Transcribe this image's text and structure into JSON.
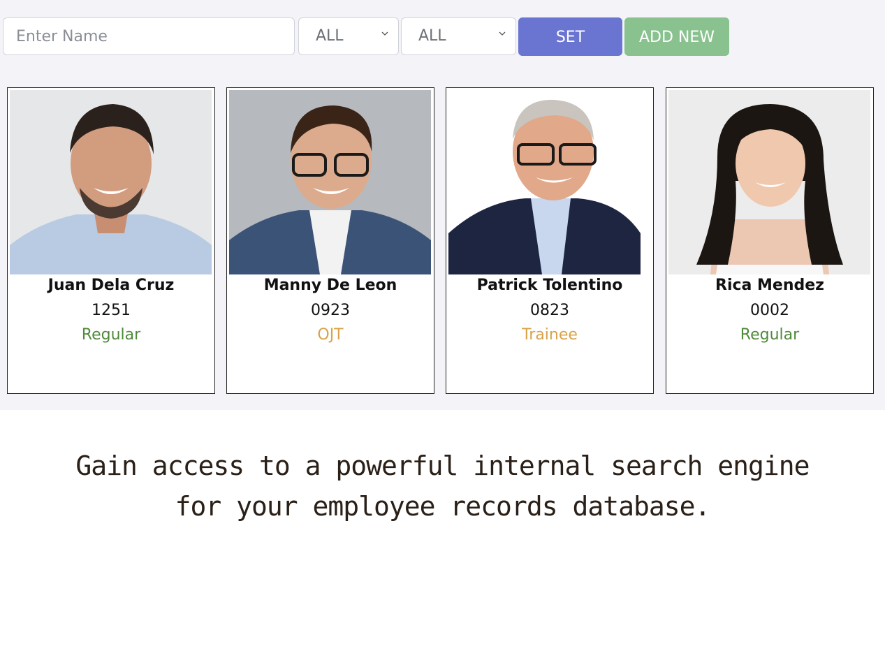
{
  "filters": {
    "name_placeholder": "Enter Name",
    "select_1_value": "ALL",
    "select_2_value": "ALL",
    "set_label": "SET",
    "add_new_label": "ADD NEW"
  },
  "employees": [
    {
      "name": "Juan Dela Cruz",
      "id": "1251",
      "status": "Regular",
      "status_color": "#4f8a3a"
    },
    {
      "name": "Manny De Leon",
      "id": "0923",
      "status": "OJT",
      "status_color": "#d9a24a"
    },
    {
      "name": "Patrick Tolentino",
      "id": "0823",
      "status": "Trainee",
      "status_color": "#d9a24a"
    },
    {
      "name": "Rica Mendez",
      "id": "0002",
      "status": "Regular",
      "status_color": "#4f8a3a"
    }
  ],
  "tagline": {
    "line1": "Gain access to a powerful internal search engine",
    "line2": "for your employee records database."
  },
  "colors": {
    "set_button": "#6a74d1",
    "add_button": "#89c28f",
    "panel_bg": "#f4f4f8"
  }
}
